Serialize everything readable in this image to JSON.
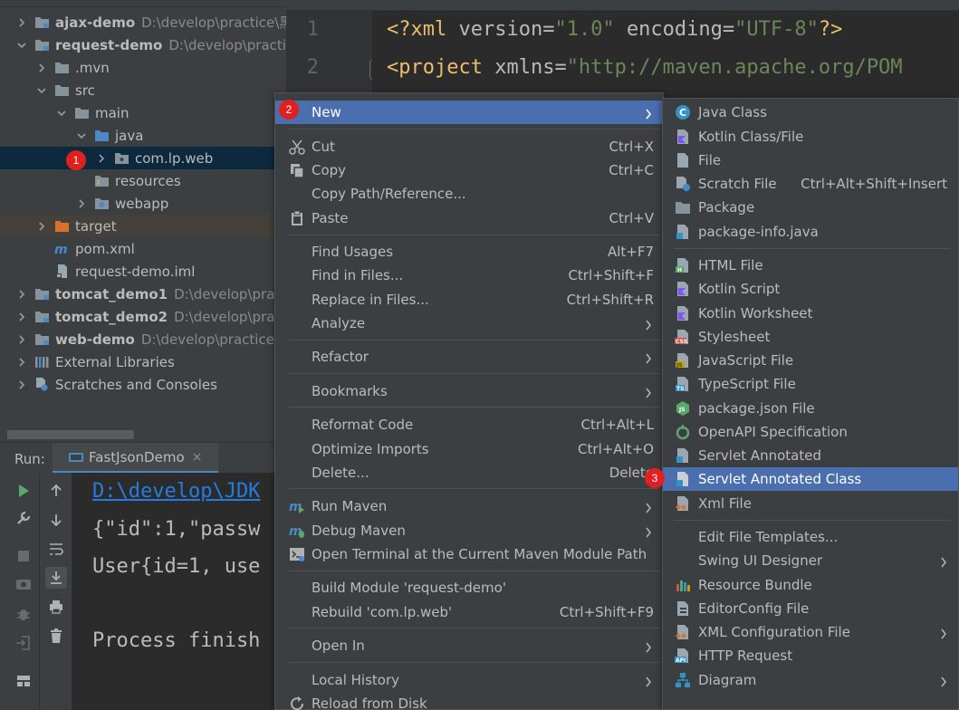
{
  "project_tree": {
    "items": [
      {
        "name": "ajax-demo",
        "path": "D:\\develop\\practice\\黑"
      },
      {
        "name": "request-demo",
        "path": "D:\\develop\\practice"
      },
      {
        "name": ".mvn"
      },
      {
        "name": "src"
      },
      {
        "name": "main"
      },
      {
        "name": "java"
      },
      {
        "name": "com.lp.web"
      },
      {
        "name": "resources"
      },
      {
        "name": "webapp"
      },
      {
        "name": "target"
      },
      {
        "name": "pom.xml"
      },
      {
        "name": "request-demo.iml"
      },
      {
        "name": "tomcat_demo1",
        "path": "D:\\develop\\pract"
      },
      {
        "name": "tomcat_demo2",
        "path": "D:\\develop\\pract"
      },
      {
        "name": "web-demo",
        "path": "D:\\develop\\practice\\"
      },
      {
        "name": "External Libraries"
      },
      {
        "name": "Scratches and Consoles"
      }
    ]
  },
  "editor": {
    "lines": [
      {
        "num": "1",
        "decl_open": "<?xml",
        "attr1": " version=",
        "val1": "\"1.0\"",
        "attr2": " encoding=",
        "val2": "\"UTF-8\"",
        "decl_close": "?>"
      },
      {
        "num": "2",
        "tag": "<project",
        "attr": " xmlns=",
        "val": "\"http://maven.apache.org/POM"
      }
    ]
  },
  "run_panel": {
    "label": "Run:",
    "tab_label": "FastJsonDemo",
    "close_glyph": "×",
    "console_lines": [
      "D:\\develop\\JDK",
      "{\"id\":1,\"passw",
      "User{id=1, use",
      "Process finish"
    ]
  },
  "context_menu": {
    "items": [
      {
        "label": "New",
        "submenu": true,
        "highlight": true
      },
      {
        "label": "Cut",
        "shortcut": "Ctrl+X",
        "icon": "scissors-icon"
      },
      {
        "label": "Copy",
        "shortcut": "Ctrl+C",
        "icon": "copy-icon"
      },
      {
        "label": "Copy Path/Reference..."
      },
      {
        "label": "Paste",
        "shortcut": "Ctrl+V",
        "icon": "paste-icon"
      },
      {
        "label": "Find Usages",
        "shortcut": "Alt+F7"
      },
      {
        "label": "Find in Files...",
        "shortcut": "Ctrl+Shift+F"
      },
      {
        "label": "Replace in Files...",
        "shortcut": "Ctrl+Shift+R"
      },
      {
        "label": "Analyze",
        "submenu": true
      },
      {
        "label": "Refactor",
        "submenu": true
      },
      {
        "label": "Bookmarks",
        "submenu": true
      },
      {
        "label": "Reformat Code",
        "shortcut": "Ctrl+Alt+L"
      },
      {
        "label": "Optimize Imports",
        "shortcut": "Ctrl+Alt+O"
      },
      {
        "label": "Delete...",
        "shortcut": "Delete"
      },
      {
        "label": "Run Maven",
        "submenu": true,
        "icon": "maven-run-icon"
      },
      {
        "label": "Debug Maven",
        "submenu": true,
        "icon": "maven-debug-icon"
      },
      {
        "label": "Open Terminal at the Current Maven Module Path",
        "icon": "terminal-icon"
      },
      {
        "label": "Build Module 'request-demo'"
      },
      {
        "label": "Rebuild 'com.lp.web'",
        "shortcut": "Ctrl+Shift+F9"
      },
      {
        "label": "Open In",
        "submenu": true
      },
      {
        "label": "Local History",
        "submenu": true
      },
      {
        "label": "Reload from Disk",
        "icon": "reload-icon"
      }
    ]
  },
  "new_submenu": {
    "items": [
      {
        "label": "Java Class",
        "icon": "java-class-icon"
      },
      {
        "label": "Kotlin Class/File",
        "icon": "kotlin-class-icon"
      },
      {
        "label": "File",
        "icon": "file-icon"
      },
      {
        "label": "Scratch File",
        "shortcut": "Ctrl+Alt+Shift+Insert",
        "icon": "scratch-file-icon"
      },
      {
        "label": "Package",
        "icon": "package-icon"
      },
      {
        "label": "package-info.java",
        "icon": "package-info-icon"
      },
      {
        "label": "HTML File",
        "icon": "html-file-icon",
        "badge": "H"
      },
      {
        "label": "Kotlin Script",
        "icon": "kotlin-script-icon"
      },
      {
        "label": "Kotlin Worksheet",
        "icon": "kotlin-worksheet-icon"
      },
      {
        "label": "Stylesheet",
        "icon": "stylesheet-icon",
        "badge": "CSS"
      },
      {
        "label": "JavaScript File",
        "icon": "javascript-file-icon",
        "badge": "JS"
      },
      {
        "label": "TypeScript File",
        "icon": "typescript-file-icon",
        "badge": "TS"
      },
      {
        "label": "package.json File",
        "icon": "nodejs-icon"
      },
      {
        "label": "OpenAPI Specification",
        "icon": "openapi-icon"
      },
      {
        "label": "Servlet Annotated",
        "icon": "servlet-icon"
      },
      {
        "label": "Servlet Annotated Class",
        "icon": "servlet-class-icon",
        "highlight": true
      },
      {
        "label": "Xml File",
        "icon": "xml-file-icon"
      },
      {
        "label": "Edit File Templates..."
      },
      {
        "label": "Swing UI Designer",
        "submenu": true
      },
      {
        "label": "Resource Bundle",
        "icon": "resource-bundle-icon"
      },
      {
        "label": "EditorConfig File",
        "icon": "editorconfig-icon"
      },
      {
        "label": "XML Configuration File",
        "submenu": true,
        "icon": "xml-config-icon"
      },
      {
        "label": "HTTP Request",
        "icon": "http-request-icon",
        "badge": "API"
      },
      {
        "label": "Diagram",
        "submenu": true,
        "icon": "diagram-icon"
      }
    ]
  },
  "steps": [
    "1",
    "2",
    "3"
  ],
  "colors": {
    "highlight": "#4b6eaf",
    "badge": "#e02020",
    "selected_row": "#0d293e"
  }
}
